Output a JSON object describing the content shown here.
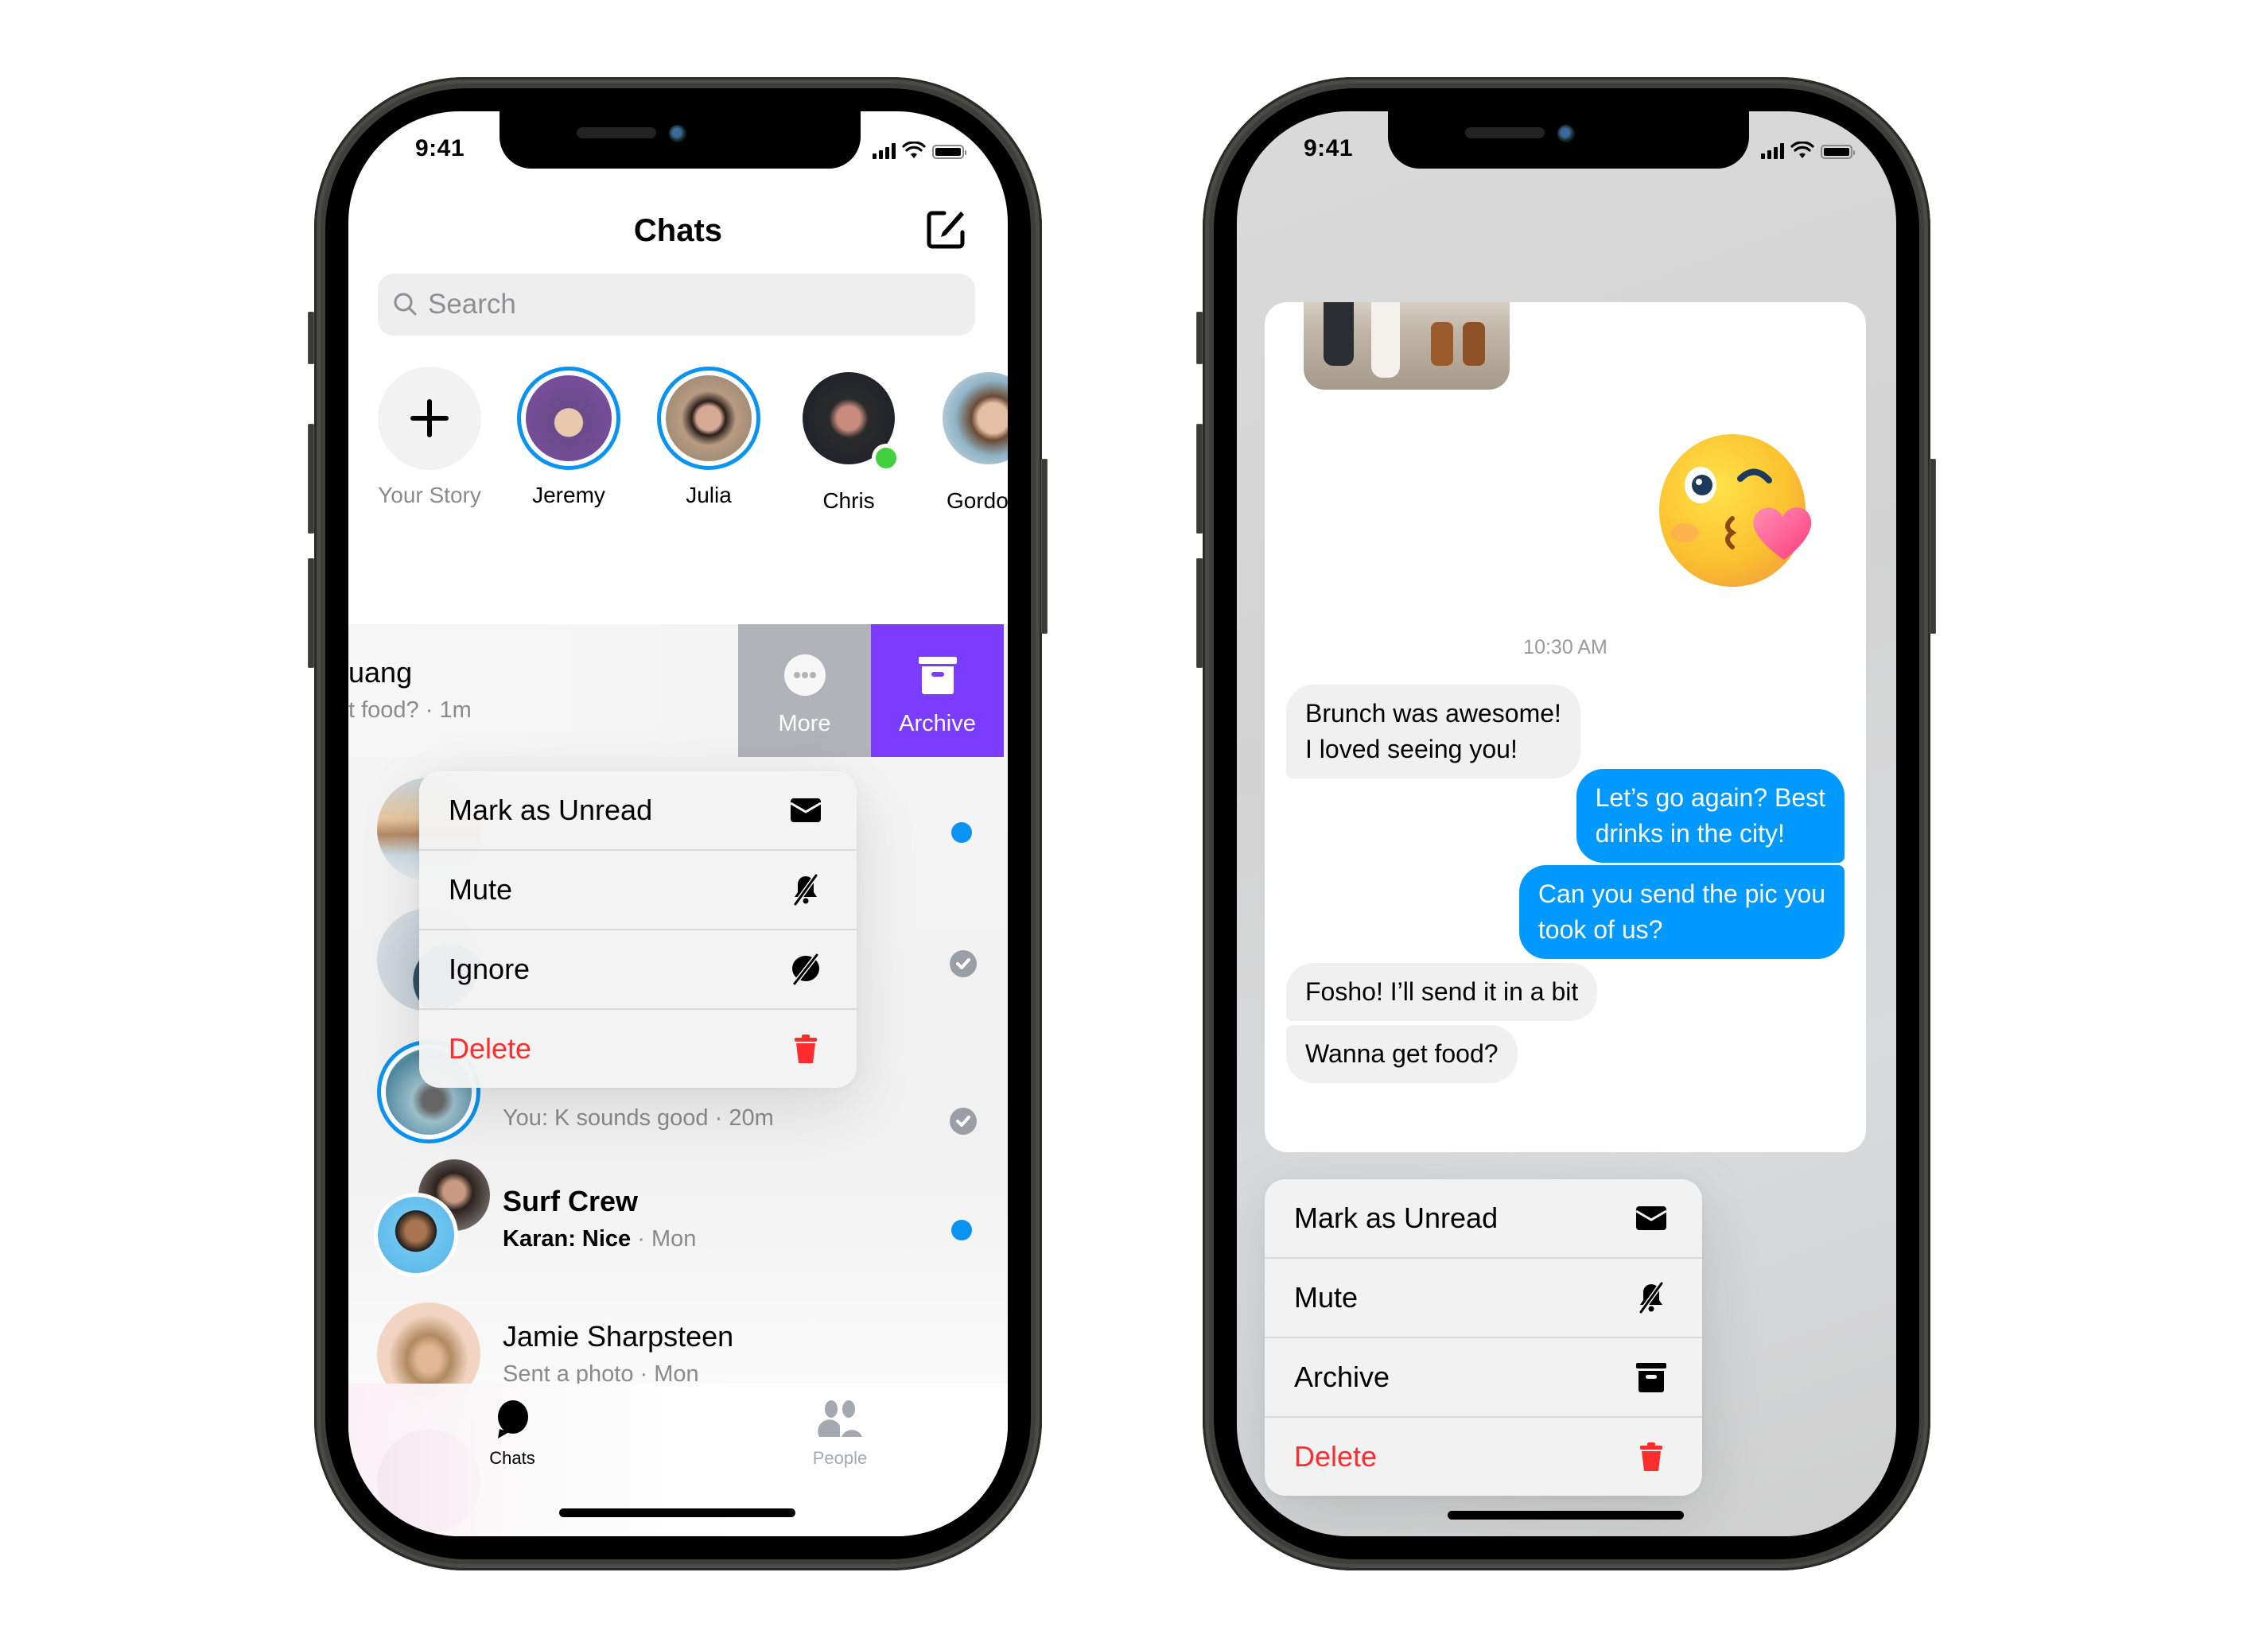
{
  "left_phone": {
    "status_bar": {
      "time": "9:41"
    },
    "header": {
      "title": "Chats",
      "compose_icon": "compose-icon"
    },
    "search": {
      "placeholder": "Search",
      "value": ""
    },
    "stories": [
      {
        "label": "Your Story",
        "type": "add",
        "active": false
      },
      {
        "label": "Jeremy",
        "active": true
      },
      {
        "label": "Julia",
        "active": true
      },
      {
        "label": "Chris",
        "active": false,
        "online": true
      },
      {
        "label": "Gordo",
        "active": false
      }
    ],
    "swiped_row": {
      "name_partial": "uang",
      "preview_partial": "t food? · 1m",
      "actions": [
        {
          "label": "More",
          "icon": "more-icon",
          "color": "#b1b3b8"
        },
        {
          "label": "Archive",
          "icon": "archive-icon",
          "color": "#7b3cff"
        }
      ]
    },
    "context_menu": [
      {
        "label": "Mark as Unread",
        "icon": "envelope-icon"
      },
      {
        "label": "Mute",
        "icon": "bell-slash-icon"
      },
      {
        "label": "Ignore",
        "icon": "ignore-icon"
      },
      {
        "label": "Delete",
        "icon": "trash-icon",
        "danger": true
      }
    ],
    "chats": [
      {
        "status": "unread"
      },
      {
        "status": "read"
      },
      {
        "preview": "You: K sounds good",
        "time": "20m",
        "status": "read"
      },
      {
        "name": "Surf Crew",
        "preview_sender": "Karan: Nice",
        "time": "Mon",
        "status": "unread"
      },
      {
        "name": "Jamie Sharpsteen",
        "preview": "Sent a photo",
        "time": "Mon"
      }
    ],
    "tabs": [
      {
        "label": "Chats",
        "icon": "chat-bubble-icon",
        "active": true
      },
      {
        "label": "People",
        "icon": "people-icon",
        "active": false
      }
    ]
  },
  "right_phone": {
    "status_bar": {
      "time": "9:41"
    },
    "conversation": {
      "timestamp": "10:30 AM",
      "messages": [
        {
          "direction": "in",
          "text_lines": [
            "Brunch was awesome!",
            "I loved seeing you!"
          ]
        },
        {
          "direction": "out",
          "text_lines": [
            "Let’s go again? Best",
            "drinks in the city!"
          ]
        },
        {
          "direction": "out",
          "text_lines": [
            "Can you send the pic you",
            "took of us?"
          ]
        },
        {
          "direction": "in",
          "text_lines": [
            "Fosho! I’ll send it in a bit"
          ]
        },
        {
          "direction": "in",
          "text_lines": [
            "Wanna get food?"
          ]
        }
      ]
    },
    "context_menu": [
      {
        "label": "Mark as Unread",
        "icon": "envelope-icon"
      },
      {
        "label": "Mute",
        "icon": "bell-slash-icon"
      },
      {
        "label": "Archive",
        "icon": "archive-icon"
      },
      {
        "label": "Delete",
        "icon": "trash-icon",
        "danger": true
      }
    ]
  },
  "colors": {
    "messenger_blue": "#0099ff",
    "story_ring": "#0a93f0",
    "archive_purple": "#7b3cff",
    "more_gray": "#b1b3b8",
    "delete_red": "#fe2d2d",
    "online_green": "#42d03f"
  }
}
